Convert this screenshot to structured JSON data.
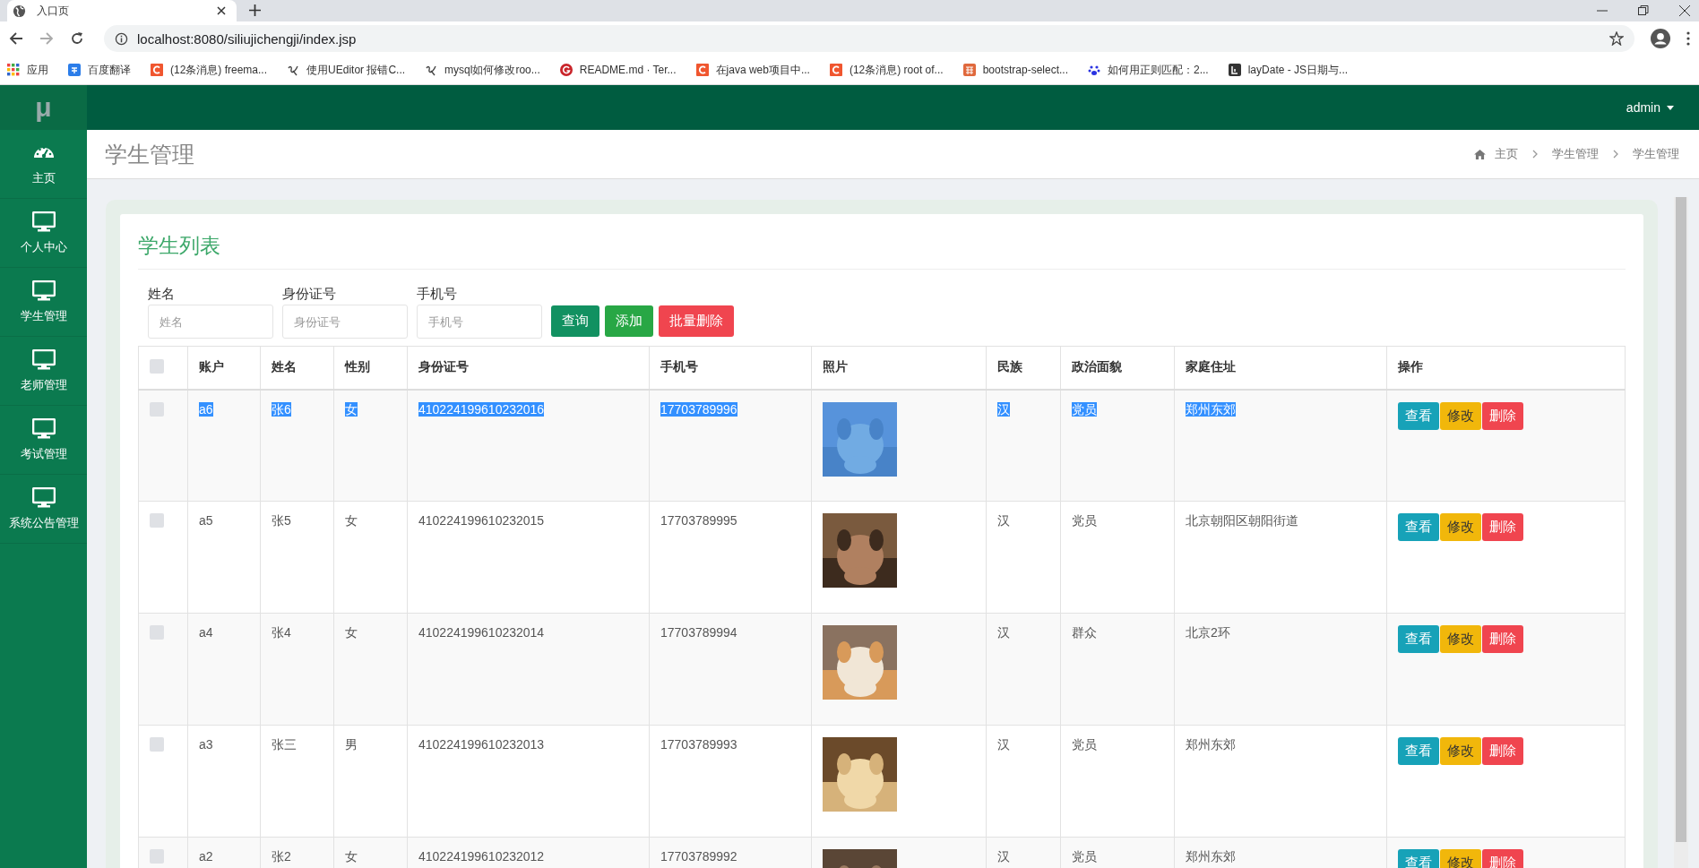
{
  "browser": {
    "tab_title": "入口页",
    "url": "localhost:8080/siliujichengji/index.jsp",
    "bookmarks": [
      "应用",
      "百度翻译",
      "(12条消息) freema...",
      "使用UEditor 报错C...",
      "mysql如何修改roo...",
      "README.md · Ter...",
      "在java web项目中...",
      "(12条消息) root of...",
      "bootstrap-select...",
      "如何用正则匹配：2...",
      "layDate - JS日期与..."
    ]
  },
  "header": {
    "logo": "μ",
    "user": "admin"
  },
  "sidebar": {
    "items": [
      {
        "label": "主页",
        "selected": false
      },
      {
        "label": "个人中心",
        "selected": false
      },
      {
        "label": "学生管理",
        "selected": false
      },
      {
        "label": "老师管理",
        "selected": false
      },
      {
        "label": "考试管理",
        "selected": false
      },
      {
        "label": "系统公告管理",
        "selected": false
      }
    ]
  },
  "page_title": "学生管理",
  "breadcrumb": [
    "主页",
    "学生管理",
    "学生管理"
  ],
  "card_title": "学生列表",
  "filters": [
    {
      "label": "姓名",
      "placeholder": "姓名"
    },
    {
      "label": "身份证号",
      "placeholder": "身份证号"
    },
    {
      "label": "手机号",
      "placeholder": "手机号"
    }
  ],
  "filter_buttons": [
    {
      "label": "查询",
      "kind": "search"
    },
    {
      "label": "添加",
      "kind": "add"
    },
    {
      "label": "批量删除",
      "kind": "delete"
    }
  ],
  "table": {
    "select_all_checked": false,
    "columns": [
      "",
      "账户",
      "姓名",
      "性别",
      "身份证号",
      "手机号",
      "照片",
      "民族",
      "政治面貌",
      "家庭住址",
      "操作"
    ],
    "rows": [
      {
        "checked": false,
        "text_selected": true,
        "cells": [
          "",
          "a6",
          "张6",
          "女",
          "410224199610232016",
          "17703789996",
          {
            "kind": "picture"
          },
          "汉",
          "党员",
          "郑州东郊"
        ],
        "actions": [
          {
            "label": "查看",
            "kind": "view"
          },
          {
            "label": "修改",
            "kind": "edit"
          },
          {
            "label": "删除",
            "kind": "delete"
          }
        ]
      },
      {
        "checked": false,
        "text_selected": false,
        "cells": [
          "",
          "a5",
          "张5",
          "女",
          "410224199610232015",
          "17703789995",
          {
            "kind": "picture"
          },
          "汉",
          "党员",
          "北京朝阳区朝阳街道"
        ],
        "actions": [
          {
            "label": "查看",
            "kind": "view"
          },
          {
            "label": "修改",
            "kind": "edit"
          },
          {
            "label": "删除",
            "kind": "delete"
          }
        ]
      },
      {
        "checked": false,
        "text_selected": false,
        "cells": [
          "",
          "a4",
          "张4",
          "女",
          "410224199610232014",
          "17703789994",
          {
            "kind": "picture"
          },
          "汉",
          "群众",
          "北京2环"
        ],
        "actions": [
          {
            "label": "查看",
            "kind": "view"
          },
          {
            "label": "修改",
            "kind": "edit"
          },
          {
            "label": "删除",
            "kind": "delete"
          }
        ]
      },
      {
        "checked": false,
        "text_selected": false,
        "cells": [
          "",
          "a3",
          "张三",
          "男",
          "410224199610232013",
          "17703789993",
          {
            "kind": "picture"
          },
          "汉",
          "党员",
          "郑州东郊"
        ],
        "actions": [
          {
            "label": "查看",
            "kind": "view"
          },
          {
            "label": "修改",
            "kind": "edit"
          },
          {
            "label": "删除",
            "kind": "delete"
          }
        ]
      },
      {
        "checked": false,
        "text_selected": false,
        "cells": [
          "",
          "a2",
          "张2",
          "女",
          "410224199610232012",
          "17703789992",
          {
            "kind": "picture"
          },
          "汉",
          "党员",
          "郑州东郊"
        ],
        "actions": [
          {
            "label": "查看",
            "kind": "view"
          },
          {
            "label": "修改",
            "kind": "edit"
          },
          {
            "label": "删除",
            "kind": "delete"
          }
        ]
      }
    ]
  }
}
